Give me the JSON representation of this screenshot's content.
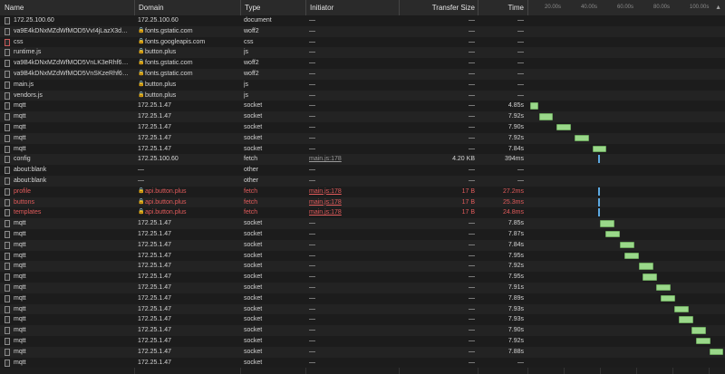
{
  "columns": {
    "name": "Name",
    "domain": "Domain",
    "type": "Type",
    "initiator": "Initiator",
    "transfer_size": "Transfer Size",
    "time": "Time"
  },
  "timeline_ticks": [
    "20.00s",
    "40.00s",
    "60.00s",
    "80.00s",
    "100.00s"
  ],
  "colors": {
    "error_text": "#e25b5b",
    "socket_bar": "#9ad88a",
    "fetch_tick": "#5ca8e0"
  },
  "rows": [
    {
      "name": "172.25.100.60",
      "domain": "172.25.100.60",
      "lock": false,
      "type": "document",
      "initiator": "—",
      "size": "—",
      "time": "—",
      "icon": "document-icon"
    },
    {
      "name": "va9E4kDNxMZdWfMOD5VvI4jLazX3dA…",
      "domain": "fonts.gstatic.com",
      "lock": true,
      "type": "woff2",
      "initiator": "—",
      "size": "—",
      "time": "—",
      "icon": "font-file-icon"
    },
    {
      "name": "css",
      "domain": "fonts.googleapis.com",
      "lock": true,
      "type": "css",
      "initiator": "—",
      "size": "—",
      "time": "—",
      "icon": "css-file-icon"
    },
    {
      "name": "runtime.js",
      "domain": "button.plus",
      "lock": true,
      "type": "js",
      "initiator": "—",
      "size": "—",
      "time": "—",
      "icon": "script-file-icon"
    },
    {
      "name": "va9B4kDNxMZdWfMOD5VnLK3eRhf6Xl…",
      "domain": "fonts.gstatic.com",
      "lock": true,
      "type": "woff2",
      "initiator": "—",
      "size": "—",
      "time": "—",
      "icon": "font-file-icon"
    },
    {
      "name": "va9B4kDNxMZdWfMOD5VnSKzeRhf6Xl…",
      "domain": "fonts.gstatic.com",
      "lock": true,
      "type": "woff2",
      "initiator": "—",
      "size": "—",
      "time": "—",
      "icon": "font-file-icon"
    },
    {
      "name": "main.js",
      "domain": "button.plus",
      "lock": true,
      "type": "js",
      "initiator": "—",
      "size": "—",
      "time": "—",
      "icon": "script-file-icon"
    },
    {
      "name": "vendors.js",
      "domain": "button.plus",
      "lock": true,
      "type": "js",
      "initiator": "—",
      "size": "—",
      "time": "—",
      "icon": "script-file-icon"
    },
    {
      "name": "mqtt",
      "domain": "172.25.1.47",
      "lock": false,
      "type": "socket",
      "initiator": "—",
      "size": "—",
      "time": "4.85s",
      "icon": "socket-icon",
      "bar": {
        "kind": "bar",
        "start": 0.3,
        "dur": 4.85
      }
    },
    {
      "name": "mqtt",
      "domain": "172.25.1.47",
      "lock": false,
      "type": "socket",
      "initiator": "—",
      "size": "—",
      "time": "7.92s",
      "icon": "socket-icon",
      "bar": {
        "kind": "bar",
        "start": 5.3,
        "dur": 7.92
      }
    },
    {
      "name": "mqtt",
      "domain": "172.25.1.47",
      "lock": false,
      "type": "socket",
      "initiator": "—",
      "size": "—",
      "time": "7.90s",
      "icon": "socket-icon",
      "bar": {
        "kind": "bar",
        "start": 15.2,
        "dur": 7.9
      }
    },
    {
      "name": "mqtt",
      "domain": "172.25.1.47",
      "lock": false,
      "type": "socket",
      "initiator": "—",
      "size": "—",
      "time": "7.92s",
      "icon": "socket-icon",
      "bar": {
        "kind": "bar",
        "start": 25.0,
        "dur": 7.92
      }
    },
    {
      "name": "mqtt",
      "domain": "172.25.1.47",
      "lock": false,
      "type": "socket",
      "initiator": "—",
      "size": "—",
      "time": "7.84s",
      "icon": "socket-icon",
      "bar": {
        "kind": "bar",
        "start": 34.8,
        "dur": 7.84
      }
    },
    {
      "name": "config",
      "domain": "172.25.100.60",
      "lock": false,
      "type": "fetch",
      "initiator": "main.js:178",
      "size": "4.20 KB",
      "time": "394ms",
      "icon": "fetch-icon",
      "bar": {
        "kind": "tick",
        "start": 38.0,
        "dur": 0.394
      }
    },
    {
      "name": "about:blank",
      "domain": "—",
      "lock": false,
      "type": "other",
      "initiator": "—",
      "size": "—",
      "time": "—",
      "icon": "document-icon"
    },
    {
      "name": "about:blank",
      "domain": "—",
      "lock": false,
      "type": "other",
      "initiator": "—",
      "size": "—",
      "time": "—",
      "icon": "document-icon"
    },
    {
      "name": "profile",
      "domain": "api.button.plus",
      "lock": true,
      "type": "fetch",
      "initiator": "main.js:178",
      "size": "17 B",
      "time": "27.2ms",
      "icon": "fetch-icon",
      "error": true,
      "bar": {
        "kind": "tick",
        "start": 38.2,
        "dur": 0.0272
      }
    },
    {
      "name": "buttons",
      "domain": "api.button.plus",
      "lock": true,
      "type": "fetch",
      "initiator": "main.js:178",
      "size": "17 B",
      "time": "25.3ms",
      "icon": "fetch-icon",
      "error": true,
      "bar": {
        "kind": "tick",
        "start": 38.2,
        "dur": 0.0253
      }
    },
    {
      "name": "templates",
      "domain": "api.button.plus",
      "lock": true,
      "type": "fetch",
      "initiator": "main.js:178",
      "size": "17 B",
      "time": "24.8ms",
      "icon": "fetch-icon",
      "error": true,
      "bar": {
        "kind": "tick",
        "start": 38.2,
        "dur": 0.0248
      }
    },
    {
      "name": "mqtt",
      "domain": "172.25.1.47",
      "lock": false,
      "type": "socket",
      "initiator": "—",
      "size": "—",
      "time": "7.85s",
      "icon": "socket-icon",
      "bar": {
        "kind": "bar",
        "start": 39.0,
        "dur": 7.85
      }
    },
    {
      "name": "mqtt",
      "domain": "172.25.1.47",
      "lock": false,
      "type": "socket",
      "initiator": "—",
      "size": "—",
      "time": "7.87s",
      "icon": "socket-icon",
      "bar": {
        "kind": "bar",
        "start": 42.0,
        "dur": 7.87
      }
    },
    {
      "name": "mqtt",
      "domain": "172.25.1.47",
      "lock": false,
      "type": "socket",
      "initiator": "—",
      "size": "—",
      "time": "7.84s",
      "icon": "socket-icon",
      "bar": {
        "kind": "bar",
        "start": 50.0,
        "dur": 7.84
      }
    },
    {
      "name": "mqtt",
      "domain": "172.25.1.47",
      "lock": false,
      "type": "socket",
      "initiator": "—",
      "size": "—",
      "time": "7.95s",
      "icon": "socket-icon",
      "bar": {
        "kind": "bar",
        "start": 52.5,
        "dur": 7.95
      }
    },
    {
      "name": "mqtt",
      "domain": "172.25.1.47",
      "lock": false,
      "type": "socket",
      "initiator": "—",
      "size": "—",
      "time": "7.92s",
      "icon": "socket-icon",
      "bar": {
        "kind": "bar",
        "start": 60.5,
        "dur": 7.92
      }
    },
    {
      "name": "mqtt",
      "domain": "172.25.1.47",
      "lock": false,
      "type": "socket",
      "initiator": "—",
      "size": "—",
      "time": "7.95s",
      "icon": "socket-icon",
      "bar": {
        "kind": "bar",
        "start": 62.5,
        "dur": 7.95
      }
    },
    {
      "name": "mqtt",
      "domain": "172.25.1.47",
      "lock": false,
      "type": "socket",
      "initiator": "—",
      "size": "—",
      "time": "7.91s",
      "icon": "socket-icon",
      "bar": {
        "kind": "bar",
        "start": 70.2,
        "dur": 7.91
      }
    },
    {
      "name": "mqtt",
      "domain": "172.25.1.47",
      "lock": false,
      "type": "socket",
      "initiator": "—",
      "size": "—",
      "time": "7.89s",
      "icon": "socket-icon",
      "bar": {
        "kind": "bar",
        "start": 72.5,
        "dur": 7.89
      }
    },
    {
      "name": "mqtt",
      "domain": "172.25.1.47",
      "lock": false,
      "type": "socket",
      "initiator": "—",
      "size": "—",
      "time": "7.93s",
      "icon": "socket-icon",
      "bar": {
        "kind": "bar",
        "start": 80.0,
        "dur": 7.93
      }
    },
    {
      "name": "mqtt",
      "domain": "172.25.1.47",
      "lock": false,
      "type": "socket",
      "initiator": "—",
      "size": "—",
      "time": "7.93s",
      "icon": "socket-icon",
      "bar": {
        "kind": "bar",
        "start": 82.5,
        "dur": 7.93
      }
    },
    {
      "name": "mqtt",
      "domain": "172.25.1.47",
      "lock": false,
      "type": "socket",
      "initiator": "—",
      "size": "—",
      "time": "7.90s",
      "icon": "socket-icon",
      "bar": {
        "kind": "bar",
        "start": 89.5,
        "dur": 7.9
      }
    },
    {
      "name": "mqtt",
      "domain": "172.25.1.47",
      "lock": false,
      "type": "socket",
      "initiator": "—",
      "size": "—",
      "time": "7.92s",
      "icon": "socket-icon",
      "bar": {
        "kind": "bar",
        "start": 92.0,
        "dur": 7.92
      }
    },
    {
      "name": "mqtt",
      "domain": "172.25.1.47",
      "lock": false,
      "type": "socket",
      "initiator": "—",
      "size": "—",
      "time": "7.88s",
      "icon": "socket-icon",
      "bar": {
        "kind": "bar",
        "start": 99.5,
        "dur": 7.88
      }
    },
    {
      "name": "mqtt",
      "domain": "172.25.1.47",
      "lock": false,
      "type": "socket",
      "initiator": "—",
      "size": "—",
      "time": "—",
      "icon": "socket-icon"
    }
  ]
}
